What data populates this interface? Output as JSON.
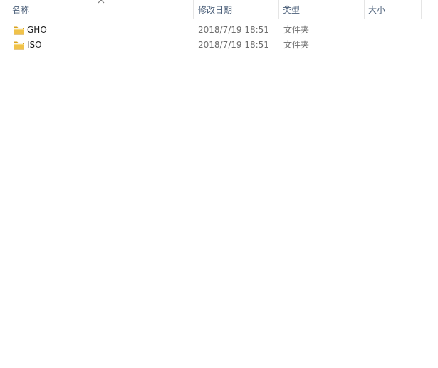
{
  "columns": {
    "name": "名称",
    "date_modified": "修改日期",
    "type": "类型",
    "size": "大小"
  },
  "sort": {
    "column": "name",
    "direction": "ascending",
    "icon": "sort-caret-up-icon"
  },
  "files": [
    {
      "name": "GHO",
      "date_modified": "2018/7/19 18:51",
      "type": "文件夹",
      "size": "",
      "icon": "folder-icon"
    },
    {
      "name": "ISO",
      "date_modified": "2018/7/19 18:51",
      "type": "文件夹",
      "size": "",
      "icon": "folder-icon"
    }
  ],
  "colors": {
    "header_text": "#4c607a",
    "secondary_text": "#6d6d6d",
    "folder_yellow": "#e8b83c"
  }
}
